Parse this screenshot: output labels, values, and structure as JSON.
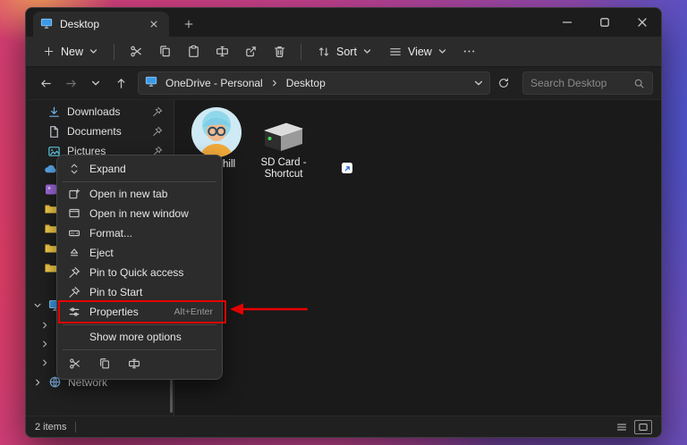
{
  "colors": {
    "annotation_red": "#e60000",
    "menu_bg": "#2c2c2c",
    "window_bg": "#202020",
    "accent_blue": "#3b9ae8"
  },
  "titlebar": {
    "tab_title": "Desktop"
  },
  "toolbar": {
    "new_label": "New",
    "sort_label": "Sort",
    "view_label": "View"
  },
  "address": {
    "breadcrumb_root": "OneDrive - Personal",
    "breadcrumb_current": "Desktop",
    "search_placeholder": "Search Desktop"
  },
  "sidebar": {
    "items": [
      {
        "label": "Downloads",
        "pinned": true
      },
      {
        "label": "Documents",
        "pinned": true
      },
      {
        "label": "Pictures",
        "pinned": true
      },
      {
        "label": "Network",
        "pinned": false
      }
    ]
  },
  "content": {
    "items": [
      {
        "label": "churchill",
        "type": "user-avatar"
      },
      {
        "label": "SD Card - Shortcut",
        "type": "drive-shortcut"
      }
    ]
  },
  "context_menu": {
    "items": [
      {
        "label": "Expand",
        "icon": "expand-icon"
      },
      {
        "label": "Open in new tab",
        "icon": "open-new-tab-icon"
      },
      {
        "label": "Open in new window",
        "icon": "open-new-window-icon"
      },
      {
        "label": "Format...",
        "icon": "format-icon"
      },
      {
        "label": "Eject",
        "icon": "eject-icon"
      },
      {
        "label": "Pin to Quick access",
        "icon": "pin-icon"
      },
      {
        "label": "Pin to Start",
        "icon": "pin-icon"
      },
      {
        "label": "Properties",
        "shortcut": "Alt+Enter",
        "icon": "properties-icon",
        "highlighted": true
      },
      {
        "label": "Show more options",
        "icon": ""
      }
    ]
  },
  "status_bar": {
    "count_label": "2 items"
  }
}
